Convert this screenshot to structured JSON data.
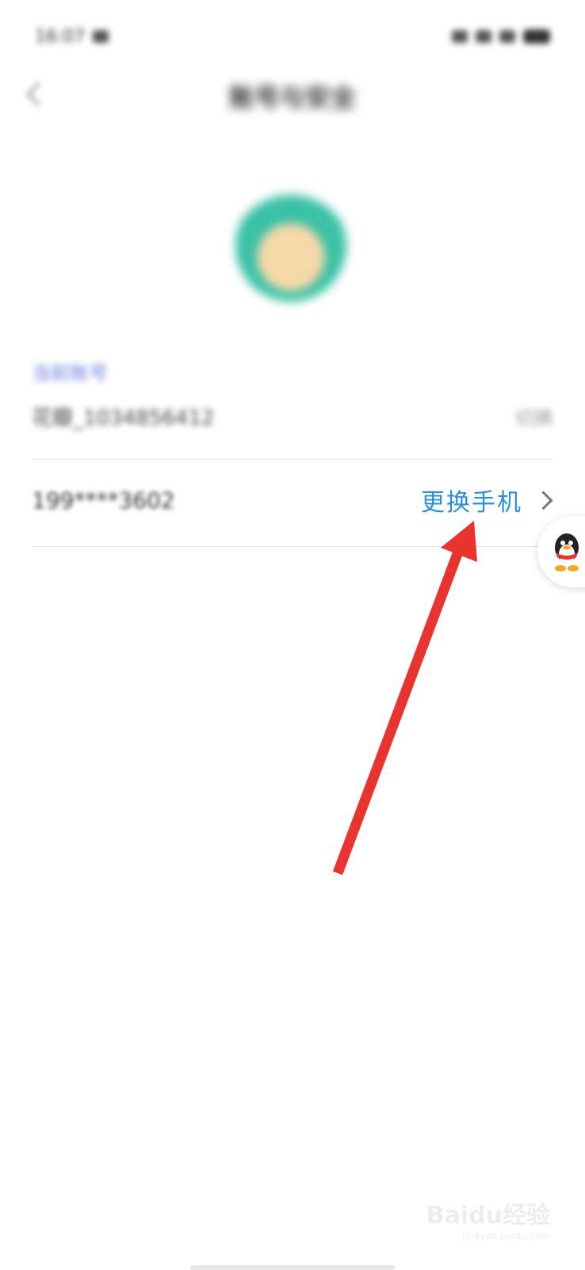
{
  "status_bar": {
    "time": "16:07"
  },
  "header": {
    "title": "账号与安全"
  },
  "account": {
    "section_label": "当前账号",
    "username": "花瓣_1034856412",
    "action_label": "切换"
  },
  "phone": {
    "masked_number": "199****3602",
    "change_label": "更换手机"
  },
  "watermark": {
    "brand": "Baidu经验",
    "url": "jingyan.baidu.com"
  },
  "colors": {
    "accent": "#2b8fd8",
    "annotation": "#e8332f"
  }
}
